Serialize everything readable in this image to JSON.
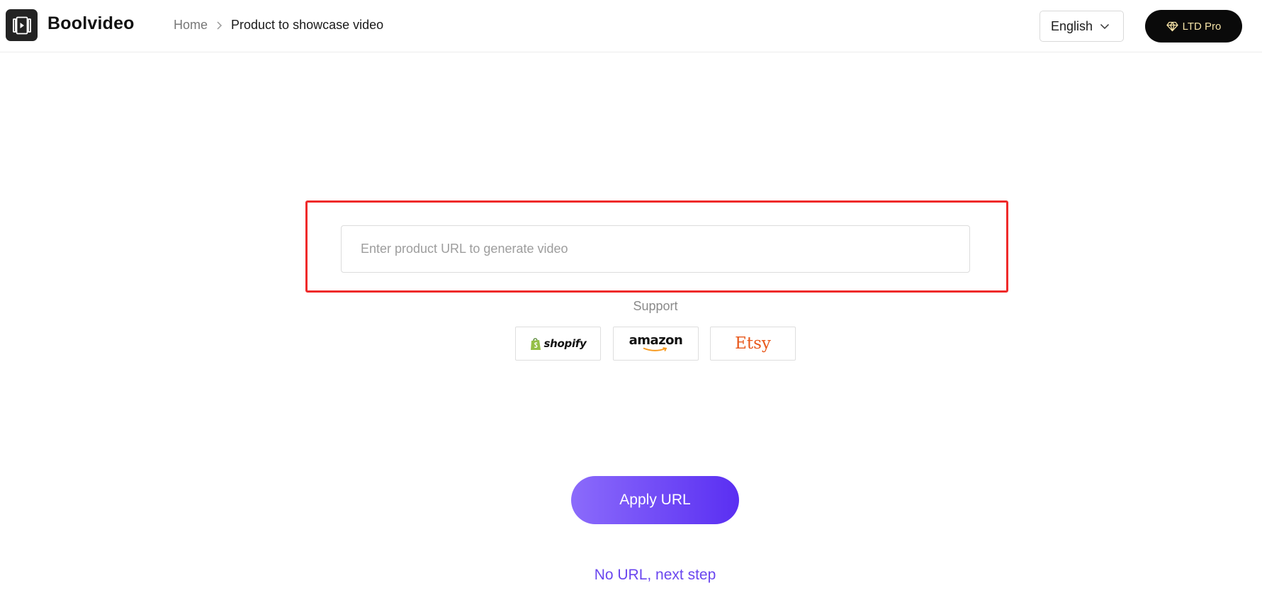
{
  "header": {
    "brand": "Boolvideo",
    "breadcrumb": {
      "home": "Home",
      "current": "Product to showcase video"
    },
    "language": {
      "selected": "English"
    },
    "pro_button": "LTD Pro"
  },
  "main": {
    "url_input": {
      "value": "",
      "placeholder": "Enter product URL to generate video"
    },
    "support_label": "Support",
    "platforms": [
      {
        "name": "shopify",
        "label": "shopify",
        "icon": "shopify-bag-icon"
      },
      {
        "name": "amazon",
        "label": "amazon",
        "icon": "amazon-smile-icon"
      },
      {
        "name": "etsy",
        "label": "Etsy"
      }
    ],
    "apply_button": "Apply URL",
    "next_link": "No URL, next step"
  },
  "colors": {
    "accent": "#6a46ef",
    "button_gradient_start": "#8b6bfb",
    "button_gradient_end": "#5a2ff2",
    "highlight": "#ef2a2a",
    "pro_text": "#f5e2a6",
    "etsy": "#e8581b",
    "shopify_green": "#95bf47",
    "amazon_orange": "#f79a1f"
  }
}
